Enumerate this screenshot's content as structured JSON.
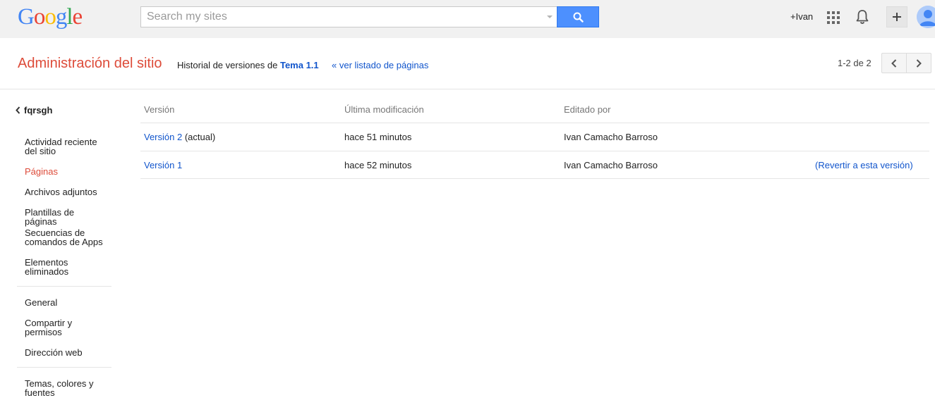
{
  "topbar": {
    "logo_letters": [
      {
        "ch": "G",
        "color": "#4285f4"
      },
      {
        "ch": "o",
        "color": "#ea4335"
      },
      {
        "ch": "o",
        "color": "#fbbc05"
      },
      {
        "ch": "g",
        "color": "#4285f4"
      },
      {
        "ch": "l",
        "color": "#34a853"
      },
      {
        "ch": "e",
        "color": "#ea4335"
      }
    ],
    "search_placeholder": "Search my sites",
    "user_link": "+Ivan",
    "icons": [
      "search-icon",
      "apps-grid-icon",
      "bell-icon",
      "plus-icon",
      "avatar-icon"
    ]
  },
  "header": {
    "title": "Administración del sitio",
    "breadcrumb_prefix": "Historial de versiones de ",
    "breadcrumb_topic": "Tema 1.1",
    "back_link": "« ver listado de páginas",
    "pager_text": "1-2 de 2"
  },
  "sidebar": {
    "site_name": "fqrsgh",
    "items": [
      {
        "label": "Actividad reciente del sitio",
        "active": false
      },
      {
        "label": "Páginas",
        "active": true
      },
      {
        "label": "Archivos adjuntos",
        "active": false
      },
      {
        "label": "Plantillas de páginas",
        "active": false
      },
      {
        "label": "Secuencias de comandos de Apps",
        "active": false
      },
      {
        "label": "Elementos eliminados",
        "active": false
      },
      {
        "label": "General",
        "active": false
      },
      {
        "label": "Compartir y permisos",
        "active": false
      },
      {
        "label": "Dirección web",
        "active": false
      },
      {
        "label": "Temas, colores y fuentes",
        "active": false
      }
    ]
  },
  "table": {
    "headers": [
      "Versión",
      "Última modificación",
      "Editado por"
    ],
    "rows": [
      {
        "version": "Versión 2",
        "suffix": " (actual)",
        "modified": "hace 51 minutos",
        "editor": "Ivan Camacho Barroso",
        "action": ""
      },
      {
        "version": "Versión 1",
        "suffix": "",
        "modified": "hace 52 minutos",
        "editor": "Ivan Camacho Barroso",
        "action": "(Revertir a esta versión)"
      }
    ]
  },
  "colors": {
    "accent_red": "#dd4b39",
    "link_blue": "#1155cc",
    "search_blue": "#4d90fe"
  }
}
